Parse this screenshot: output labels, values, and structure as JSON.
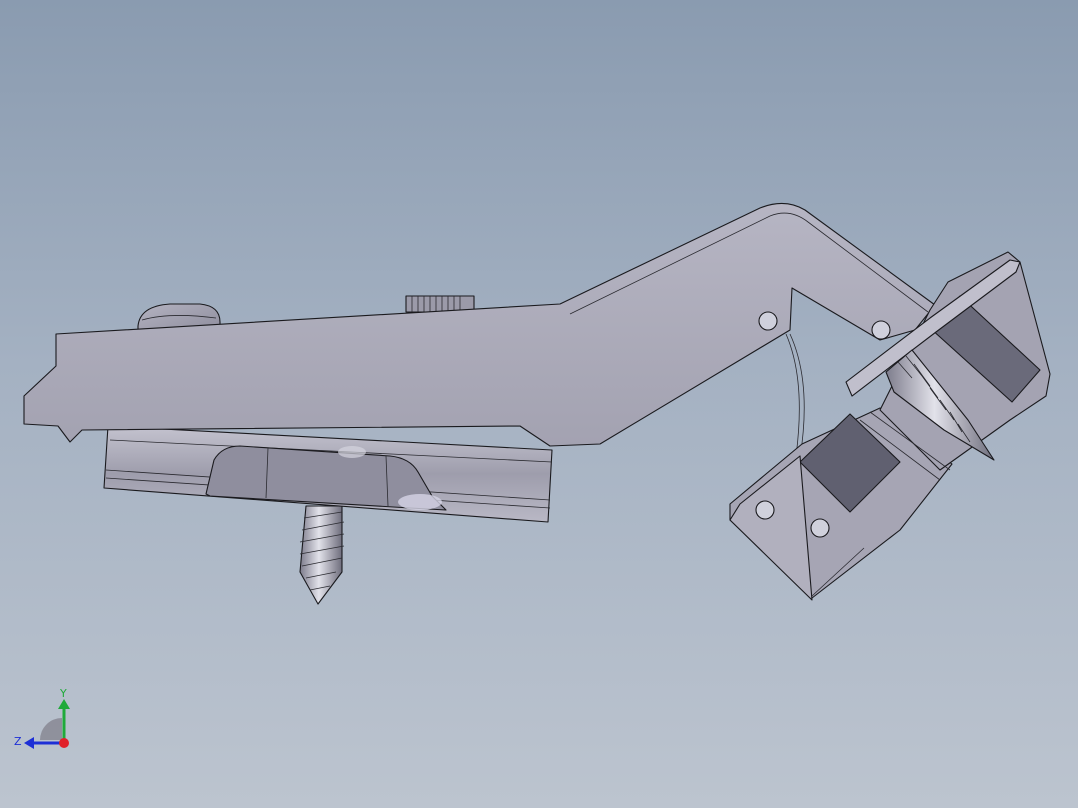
{
  "viewport": {
    "background_top": "#8a9bb0",
    "background_bottom": "#bcc4cf"
  },
  "model": {
    "part_color": "#a9a8b6",
    "shadow_color": "#6f6e7e",
    "highlight_color": "#d0d0dc"
  },
  "triad": {
    "y_label": "Y",
    "z_label": "Z",
    "y_color": "#1faa3a",
    "z_color": "#1d2fd6",
    "x_color": "#e0202a"
  }
}
